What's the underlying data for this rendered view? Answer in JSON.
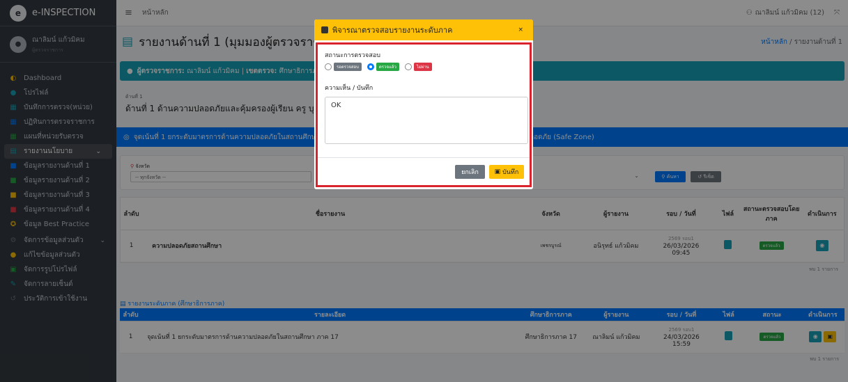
{
  "brand": {
    "name": "e-INSPECTION",
    "logo": "e"
  },
  "user": {
    "name": "ณาลิมน์ แก้วมิคม",
    "sub": "ผู้ตรวจราชการ"
  },
  "sidebar": {
    "items": [
      {
        "icon": "dashboard-icon",
        "glyph": "◐",
        "label": "Dashboard",
        "color": "#ffc107"
      },
      {
        "icon": "profile-icon",
        "glyph": "●",
        "label": "โปรไฟล์",
        "color": "#17a2b8"
      },
      {
        "icon": "record-icon",
        "glyph": "▦",
        "label": "บันทึกการตรวจ(หน่วย)",
        "color": "#17a2b8"
      },
      {
        "icon": "calendar-icon",
        "glyph": "▦",
        "label": "ปฏิทินการตรวจราชการ",
        "color": "#007bff"
      },
      {
        "icon": "units-icon",
        "glyph": "▦",
        "label": "แผนที่หน่วยรับตรวจ",
        "color": "#28a745"
      },
      {
        "icon": "policy-icon",
        "glyph": "▤",
        "label": "รายงานนโยบาย",
        "color": "#17a2b8"
      },
      {
        "icon": "file-icon",
        "glyph": "■",
        "label": "ข้อมูลรายงานด้านที่ 1",
        "color": "#007bff"
      },
      {
        "icon": "file-icon",
        "glyph": "■",
        "label": "ข้อมูลรายงานด้านที่ 2",
        "color": "#28a745"
      },
      {
        "icon": "file-icon",
        "glyph": "■",
        "label": "ข้อมูลรายงานด้านที่ 3",
        "color": "#ffc107"
      },
      {
        "icon": "file-icon",
        "glyph": "■",
        "label": "ข้อมูลรายงานด้านที่ 4",
        "color": "#dc3545"
      },
      {
        "icon": "award-icon",
        "glyph": "✪",
        "label": "ข้อมูล Best Practice",
        "color": "#ffc107"
      },
      {
        "icon": "gear-icon",
        "glyph": "⚙",
        "label": "จัดการข้อมูลส่วนตัว",
        "color": "#6c757d"
      },
      {
        "icon": "user-edit-icon",
        "glyph": "●",
        "label": "แก้ไขข้อมูลส่วนตัว",
        "color": "#ffc107"
      },
      {
        "icon": "image-icon",
        "glyph": "▣",
        "label": "จัดการรูปโปรไฟล์",
        "color": "#28a745"
      },
      {
        "icon": "signature-icon",
        "glyph": "✎",
        "label": "จัดการลายเซ็นต์",
        "color": "#17a2b8"
      },
      {
        "icon": "history-icon",
        "glyph": "↺",
        "label": "ประวัติการเข้าใช้งาน",
        "color": "#6c757d"
      }
    ]
  },
  "topbar": {
    "home": "หน้าหลัก",
    "user": "ณาลิมน์ แก้วมิคม (12)",
    "menu_glyph": "≡",
    "user_glyph": "⚇",
    "expand_glyph": "⤧"
  },
  "page": {
    "title": "รายงานด้านที่ 1 (มุมมองผู้ตรวจราชการ)",
    "crumb_home": "หน้าหลัก",
    "crumb_sep": "/",
    "crumb_current": "รายงานด้านที่ 1",
    "inspector_prefix": "ผู้ตรวจราชการ:",
    "inspector_name": "ณาลิมน์ แก้วมิคม",
    "area_prefix": "เขตตรวจ:",
    "area_name": "ศึกษาธิการภาค",
    "topic_small": "ด้านที่ 1",
    "topic_main": "ด้านที่ 1 ด้านความปลอดภัยและคุ้มครองผู้เรียน ครู บุคลากร",
    "section_title": "จุดเน้นที่ 1 ยกระดับมาตรการด้านความปลอดภัยในสถานศึกษา",
    "section_right": "ที่ปลอดภัย (Safe Zone)"
  },
  "filter": {
    "label": "จังหวัด",
    "placeholder": "-- ทุกจังหวัด --",
    "search": "ค้นหา",
    "reset": "รีเซ็ต"
  },
  "table1": {
    "headers": [
      "ลำดับ",
      "ชื่อรายงาน",
      "จังหวัด",
      "ผู้รายงาน",
      "รอบ / วันที่",
      "ไฟล์",
      "สถานะตรวจสอบโดยภาค",
      "ดำเนินการ"
    ],
    "rows": [
      {
        "no": "1",
        "name": "ความปลอดภัยสถานศึกษา",
        "province": "เพชรบูรณ์",
        "reporter": "อนิรุทธ์ แก้วมิคม",
        "round": "2569 รอบ1",
        "date": "26/03/2026",
        "time": "09:45",
        "status": "ตรวจแล้ว"
      }
    ],
    "found": "พบ 1 รายการ"
  },
  "table2": {
    "title": "รายงานระดับภาค (ศึกษาธิการภาค)",
    "headers": [
      "ลำดับ",
      "รายละเอียด",
      "ศึกษาธิการภาค",
      "ผู้รายงาน",
      "รอบ / วันที่",
      "ไฟล์",
      "สถานะ",
      "ดำเนินการ"
    ],
    "rows": [
      {
        "no": "1",
        "detail": "จุดเน้นที่ 1 ยกระดับมาตรการด้านความปลอดภัยในสถานศึกษา ภาค 17",
        "region": "ศึกษาธิการภาค 17",
        "reporter": "ณาลิมน์ แก้วมิคม",
        "round": "2569 รอบ1",
        "date": "24/03/2026",
        "time": "15:59",
        "status": "ตรวจแล้ว"
      }
    ],
    "found": "พบ 1 รายการ"
  },
  "modal": {
    "title": "พิจารณาตรวจสอบรายงานระดับภาค",
    "close": "×",
    "status_label": "สถานะการตรวจสอบ",
    "options": [
      {
        "label": "รอตรวจสอบ",
        "color": "#6c757d",
        "checked": false
      },
      {
        "label": "ตรวจแล้ว",
        "color": "#28a745",
        "checked": true
      },
      {
        "label": "ไม่ผ่าน",
        "color": "#dc3545",
        "checked": false
      }
    ],
    "note_label": "ความเห็น / บันทึก",
    "note_value": "OK",
    "cancel": "ยกเลิก",
    "save": "บันทึก"
  },
  "colors": {
    "accent": "#ffc107",
    "primary": "#007bff",
    "info": "#17a2b8",
    "success": "#28a745",
    "danger": "#dc3545",
    "highlight": "#d9232d"
  }
}
